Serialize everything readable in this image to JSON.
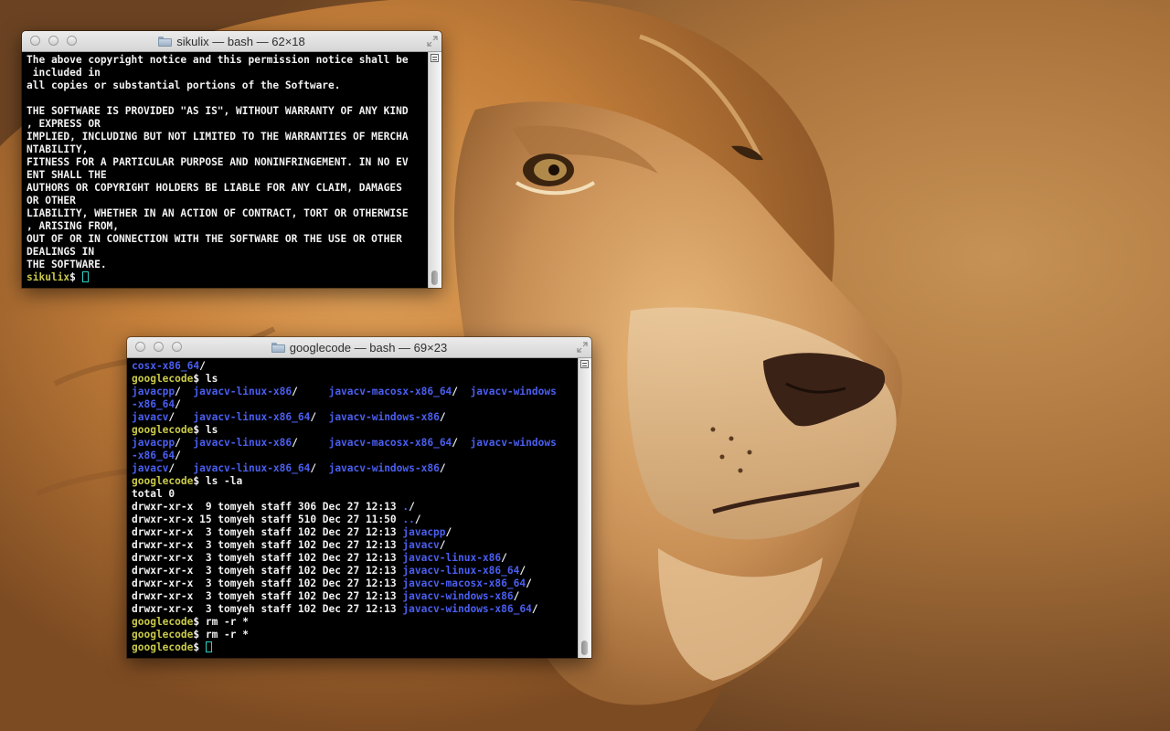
{
  "desktop": {
    "wallpaper": "lion-wallpaper",
    "accent_colors": {
      "fur_light": "#d9a35a",
      "fur_dark": "#7a4a22",
      "background": "#b07a3c"
    }
  },
  "windows": [
    {
      "title": "sikulix — bash — 62×18",
      "lines": [
        [
          {
            "t": "The above copyright notice and this permission notice shall be"
          }
        ],
        [
          {
            "t": " included in"
          }
        ],
        [
          {
            "t": "all copies or substantial portions of the Software."
          }
        ],
        [
          {
            "t": ""
          }
        ],
        [
          {
            "t": "THE SOFTWARE IS PROVIDED \"AS IS\", WITHOUT WARRANTY OF ANY KIND"
          }
        ],
        [
          {
            "t": ", EXPRESS OR"
          }
        ],
        [
          {
            "t": "IMPLIED, INCLUDING BUT NOT LIMITED TO THE WARRANTIES OF MERCHA"
          }
        ],
        [
          {
            "t": "NTABILITY,"
          }
        ],
        [
          {
            "t": "FITNESS FOR A PARTICULAR PURPOSE AND NONINFRINGEMENT. IN NO EV"
          }
        ],
        [
          {
            "t": "ENT SHALL THE"
          }
        ],
        [
          {
            "t": "AUTHORS OR COPYRIGHT HOLDERS BE LIABLE FOR ANY CLAIM, DAMAGES"
          }
        ],
        [
          {
            "t": "OR OTHER"
          }
        ],
        [
          {
            "t": "LIABILITY, WHETHER IN AN ACTION OF CONTRACT, TORT OR OTHERWISE"
          }
        ],
        [
          {
            "t": ", ARISING FROM,"
          }
        ],
        [
          {
            "t": "OUT OF OR IN CONNECTION WITH THE SOFTWARE OR THE USE OR OTHER"
          }
        ],
        [
          {
            "t": "DEALINGS IN"
          }
        ],
        [
          {
            "t": "THE SOFTWARE."
          }
        ],
        [
          {
            "t": "sikulix",
            "c": "prompt"
          },
          {
            "t": "$ "
          },
          {
            "t": "",
            "c": "cursor"
          }
        ]
      ]
    },
    {
      "title": "googlecode — bash — 69×23",
      "lines": [
        [
          {
            "t": "cosx-x86_64",
            "c": "dir"
          },
          {
            "t": "/"
          }
        ],
        [
          {
            "t": "googlecode",
            "c": "prompt"
          },
          {
            "t": "$ ls"
          }
        ],
        [
          {
            "t": "javacpp",
            "c": "dir"
          },
          {
            "t": "/  "
          },
          {
            "t": "javacv-linux-x86",
            "c": "dir"
          },
          {
            "t": "/     "
          },
          {
            "t": "javacv-macosx-x86_64",
            "c": "dir"
          },
          {
            "t": "/  "
          },
          {
            "t": "javacv-windows",
            "c": "dir"
          }
        ],
        [
          {
            "t": "-x86_64",
            "c": "dir"
          },
          {
            "t": "/"
          }
        ],
        [
          {
            "t": "javacv",
            "c": "dir"
          },
          {
            "t": "/   "
          },
          {
            "t": "javacv-linux-x86_64",
            "c": "dir"
          },
          {
            "t": "/  "
          },
          {
            "t": "javacv-windows-x86",
            "c": "dir"
          },
          {
            "t": "/"
          }
        ],
        [
          {
            "t": "googlecode",
            "c": "prompt"
          },
          {
            "t": "$ ls"
          }
        ],
        [
          {
            "t": "javacpp",
            "c": "dir"
          },
          {
            "t": "/  "
          },
          {
            "t": "javacv-linux-x86",
            "c": "dir"
          },
          {
            "t": "/     "
          },
          {
            "t": "javacv-macosx-x86_64",
            "c": "dir"
          },
          {
            "t": "/  "
          },
          {
            "t": "javacv-windows",
            "c": "dir"
          }
        ],
        [
          {
            "t": "-x86_64",
            "c": "dir"
          },
          {
            "t": "/"
          }
        ],
        [
          {
            "t": "javacv",
            "c": "dir"
          },
          {
            "t": "/   "
          },
          {
            "t": "javacv-linux-x86_64",
            "c": "dir"
          },
          {
            "t": "/  "
          },
          {
            "t": "javacv-windows-x86",
            "c": "dir"
          },
          {
            "t": "/"
          }
        ],
        [
          {
            "t": "googlecode",
            "c": "prompt"
          },
          {
            "t": "$ ls -la"
          }
        ],
        [
          {
            "t": "total 0"
          }
        ],
        [
          {
            "t": "drwxr-xr-x  9 tomyeh staff 306 Dec 27 12:13 "
          },
          {
            "t": ".",
            "c": "dir"
          },
          {
            "t": "/"
          }
        ],
        [
          {
            "t": "drwxr-xr-x 15 tomyeh staff 510 Dec 27 11:50 "
          },
          {
            "t": "..",
            "c": "dir"
          },
          {
            "t": "/"
          }
        ],
        [
          {
            "t": "drwxr-xr-x  3 tomyeh staff 102 Dec 27 12:13 "
          },
          {
            "t": "javacpp",
            "c": "dir"
          },
          {
            "t": "/"
          }
        ],
        [
          {
            "t": "drwxr-xr-x  3 tomyeh staff 102 Dec 27 12:13 "
          },
          {
            "t": "javacv",
            "c": "dir"
          },
          {
            "t": "/"
          }
        ],
        [
          {
            "t": "drwxr-xr-x  3 tomyeh staff 102 Dec 27 12:13 "
          },
          {
            "t": "javacv-linux-x86",
            "c": "dir"
          },
          {
            "t": "/"
          }
        ],
        [
          {
            "t": "drwxr-xr-x  3 tomyeh staff 102 Dec 27 12:13 "
          },
          {
            "t": "javacv-linux-x86_64",
            "c": "dir"
          },
          {
            "t": "/"
          }
        ],
        [
          {
            "t": "drwxr-xr-x  3 tomyeh staff 102 Dec 27 12:13 "
          },
          {
            "t": "javacv-macosx-x86_64",
            "c": "dir"
          },
          {
            "t": "/"
          }
        ],
        [
          {
            "t": "drwxr-xr-x  3 tomyeh staff 102 Dec 27 12:13 "
          },
          {
            "t": "javacv-windows-x86",
            "c": "dir"
          },
          {
            "t": "/"
          }
        ],
        [
          {
            "t": "drwxr-xr-x  3 tomyeh staff 102 Dec 27 12:13 "
          },
          {
            "t": "javacv-windows-x86_64",
            "c": "dir"
          },
          {
            "t": "/"
          }
        ],
        [
          {
            "t": "googlecode",
            "c": "prompt"
          },
          {
            "t": "$ rm -r *"
          }
        ],
        [
          {
            "t": "googlecode",
            "c": "prompt"
          },
          {
            "t": "$ rm -r *"
          }
        ],
        [
          {
            "t": "googlecode",
            "c": "prompt"
          },
          {
            "t": "$ "
          },
          {
            "t": "",
            "c": "cursor"
          }
        ]
      ]
    }
  ],
  "icons": {
    "close": "close-button-icon",
    "minimize": "minimize-button-icon",
    "zoom": "zoom-button-icon",
    "folder": "folder-icon",
    "resize": "fullscreen-icon",
    "scroll": "scrollbar-menu-icon"
  },
  "colors": {
    "prompt": "#c9c94a",
    "directory": "#4a5ef0",
    "text": "#f2f2f2",
    "cursor": "#2fd0c5",
    "terminal_bg": "#000000"
  }
}
